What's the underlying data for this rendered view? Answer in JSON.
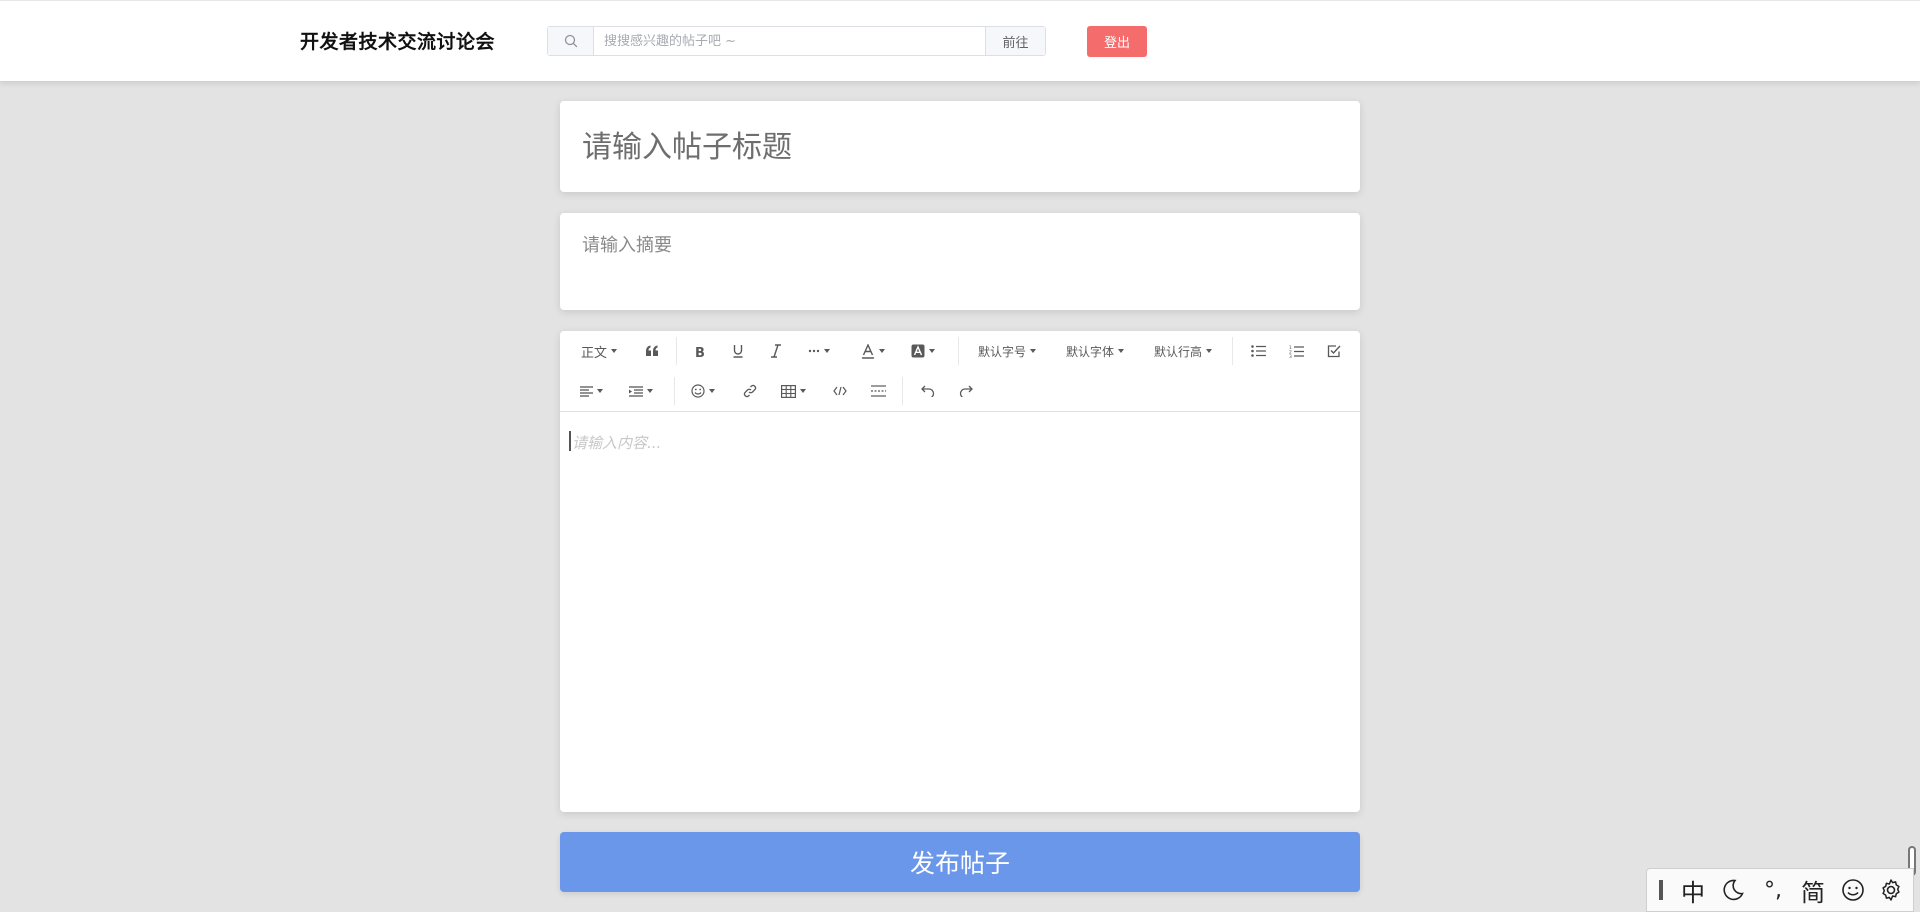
{
  "header": {
    "site_title": "开发者技术交流讨论会",
    "search": {
      "placeholder": "搜搜感兴趣的帖子吧 ~",
      "value": "",
      "go_label": "前往"
    },
    "logout_label": "登出"
  },
  "post": {
    "title_placeholder": "请输入帖子标题",
    "summary_placeholder": "请输入摘要"
  },
  "editor": {
    "toolbar": {
      "heading_label": "正文",
      "font_size_label": "默认字号",
      "font_family_label": "默认字体",
      "line_height_label": "默认行高"
    },
    "content_placeholder": "请输入内容..."
  },
  "publish_label": "发布帖子",
  "ime": {
    "lang_label": "中",
    "punct_label": "°,",
    "script_label": "简"
  },
  "colors": {
    "logout": "#f56c6c",
    "publish": "#6a97ea",
    "background": "#e3e3e3"
  }
}
